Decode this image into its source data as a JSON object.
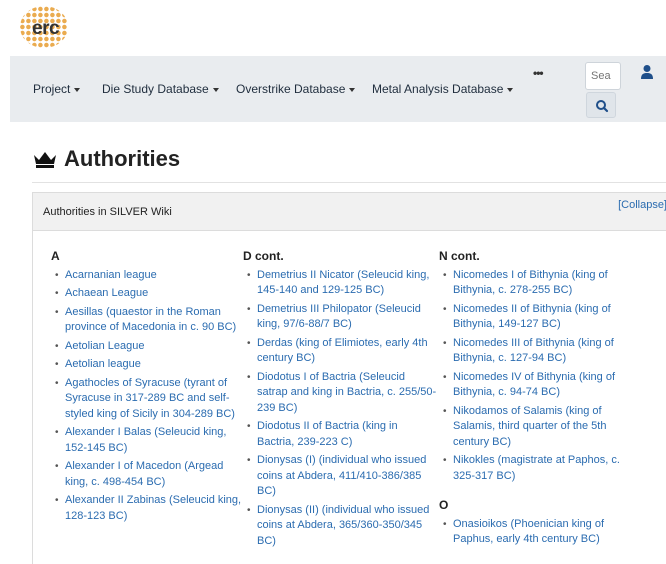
{
  "logo": {
    "text": "erc"
  },
  "nav": {
    "items": [
      {
        "label": "Project"
      },
      {
        "label": "Die Study Database"
      },
      {
        "label": "Overstrike Database"
      },
      {
        "label": "Metal Analysis Database"
      }
    ],
    "more": "•••",
    "search_placeholder": "Sea"
  },
  "page": {
    "title": "Authorities"
  },
  "panel": {
    "title": "Authorities in SILVER Wiki",
    "collapse_label": "[Collapse]"
  },
  "columns": [
    {
      "groups": [
        {
          "heading": "A",
          "items": [
            "Acarnanian league",
            "Achaean League",
            "Aesillas (quaestor in the Roman province of Macedonia in c. 90 BC)",
            "Aetolian League",
            "Aetolian league",
            "Agathocles of Syracuse (tyrant of Syracuse in 317-289 BC and self-styled king of Sicily in 304-289 BC)",
            "Alexander I Balas (Seleucid king, 152-145 BC)",
            "Alexander I of Macedon (Argead king, c. 498-454 BC)",
            "Alexander II Zabinas (Seleucid king, 128-123 BC)"
          ]
        }
      ]
    },
    {
      "groups": [
        {
          "heading": "D cont.",
          "items": [
            "Demetrius II Nicator (Seleucid king, 145-140 and 129-125 BC)",
            "Demetrius III Philopator (Seleucid king, 97/6-88/7 BC)",
            "Derdas (king of Elimiotes, early 4th century BC)",
            "Diodotus I of Bactria (Seleucid satrap and king in Bactria, c. 255/50-239 BC)",
            "Diodotus II of Bactria (king in Bactria, 239-223 C)",
            "Dionysas (I) (individual who issued coins at Abdera, 411/410-386/385 BC)",
            "Dionysas (II) (individual who issued coins at Abdera, 365/360-350/345 BC)"
          ]
        }
      ]
    },
    {
      "groups": [
        {
          "heading": "N cont.",
          "items": [
            "Nicomedes I of Bithynia (king of Bithynia, c. 278-255 BC)",
            "Nicomedes II of Bithynia (king of Bithynia, 149-127 BC)",
            "Nicomedes III of Bithynia (king of Bithynia, c. 127-94 BC)",
            "Nicomedes IV of Bithynia (king of Bithynia, c. 94-74 BC)",
            "Nikodamos of Salamis (king of Salamis, third quarter of the 5th century BC)",
            "Nikokles (magistrate at Paphos, c. 325-317 BC)"
          ]
        },
        {
          "heading": "O",
          "items": [
            "Onasioikos (Phoenician king of Paphus, early 4th century BC)"
          ]
        }
      ]
    }
  ]
}
